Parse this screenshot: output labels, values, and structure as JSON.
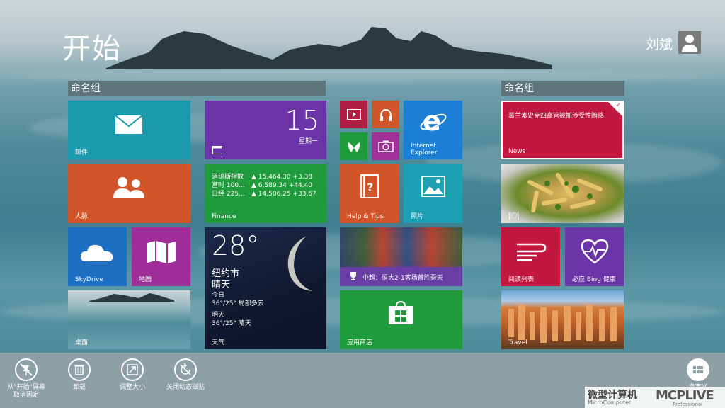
{
  "header": {
    "title": "开始",
    "user_name": "刘斌"
  },
  "groups": [
    "命名组",
    "命名组"
  ],
  "tiles": {
    "mail": "邮件",
    "calendar": {
      "day": "15",
      "weekday": "星期一"
    },
    "people": "人脉",
    "finance": {
      "label": "Finance",
      "rows": [
        {
          "name": "道琼斯指数",
          "value": "▲ 15,464.30 +3.38"
        },
        {
          "name": "富时 100...",
          "value": "▲ 6,589.34 +44.40"
        },
        {
          "name": "日经 225...",
          "value": "▲ 14,506.25 +33.67"
        }
      ]
    },
    "skydrive": "SkyDrive",
    "maps": "地图",
    "weather": {
      "temp": "28°",
      "city": "纽约市",
      "condition": "晴天",
      "today_label": "今日",
      "today": "36°/25° 局部多云",
      "tomorrow_label": "明天",
      "tomorrow": "36°/25° 晴天",
      "label": "天气"
    },
    "desktop": "桌面",
    "ie": "Internet\nExplorer",
    "help": "Help & Tips",
    "photos": "照片",
    "sports": "中超：恒大2-1客场首胜舜天",
    "store": "应用商店",
    "news": {
      "headline": "葛兰素史克四高管被抓涉受性贿赂",
      "label": "News"
    },
    "reading": "阅读列表",
    "health": "必应 Bing 健康",
    "travel": "Travel"
  },
  "appbar": {
    "unpin": "从\"开始\"屏幕\n取消固定",
    "uninstall": "卸载",
    "resize": "调整大小",
    "live_off": "关闭动态磁贴",
    "customize": "自定义"
  },
  "watermark": {
    "cn": "微型计算机",
    "en": "MicroComputer",
    "logo": "MCPLIVE",
    "sub": "Professional"
  }
}
